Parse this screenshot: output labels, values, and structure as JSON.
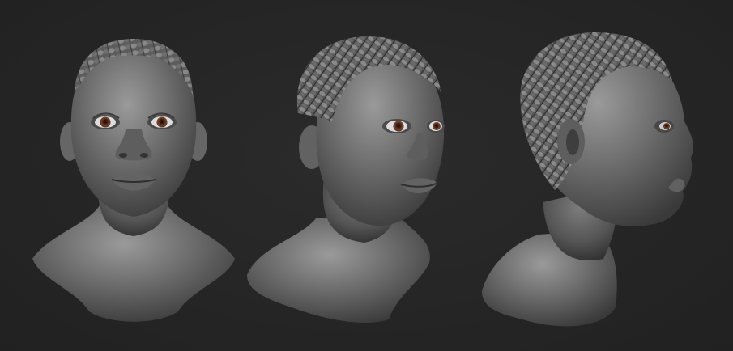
{
  "scene": {
    "background_color": "#262626",
    "clay_color": "#6e6e6e",
    "eye_color": "#6b3a22",
    "views": [
      {
        "id": "front",
        "pose": "front"
      },
      {
        "id": "three-quarter",
        "pose": "three-quarter"
      },
      {
        "id": "profile",
        "pose": "right-profile"
      }
    ]
  }
}
